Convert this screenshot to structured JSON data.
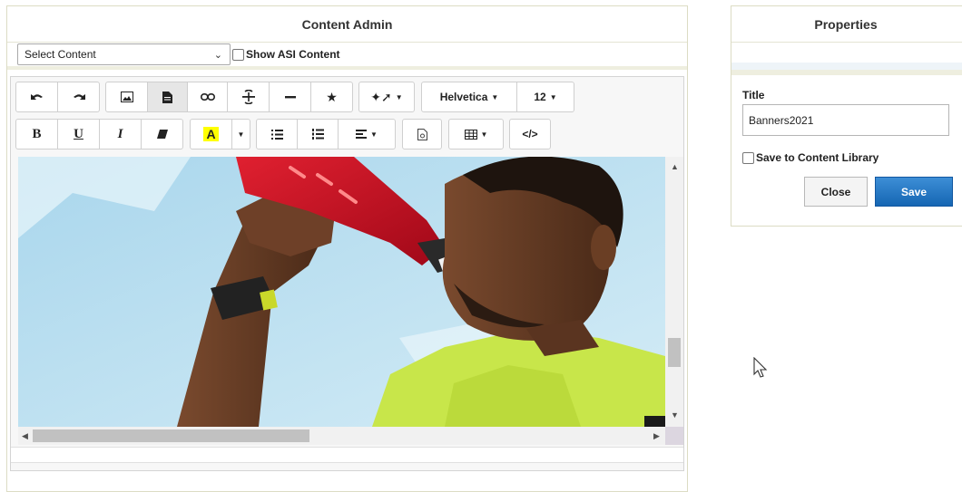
{
  "content_admin": {
    "title": "Content Admin",
    "select_content": {
      "value": "Select Content"
    },
    "show_asi_label": "Show ASI Content"
  },
  "toolbar": {
    "font_family": "Helvetica",
    "font_size": "12",
    "code_view": "</>",
    "bold": "B",
    "underline": "U",
    "italic": "I",
    "highlight": "A"
  },
  "editor": {
    "image_alt": "Man drinking from a red sports bottle"
  },
  "properties": {
    "title": "Properties",
    "title_label": "Title",
    "title_value": "Banners2021",
    "save_library_label": "Save to Content Library",
    "close_label": "Close",
    "save_label": "Save"
  },
  "colors": {
    "save_button": "#1f72c0",
    "highlight": "#ffff00",
    "panel_border": "#dcdcc4"
  }
}
